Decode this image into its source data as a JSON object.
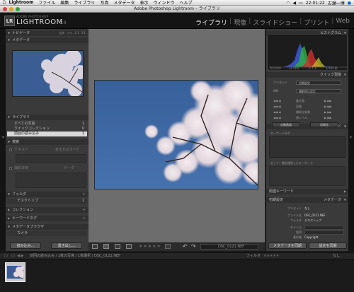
{
  "menubar": {
    "app": "Lightroom",
    "items": [
      "ファイル",
      "編集",
      "ライブラリ",
      "写真",
      "メタデータ",
      "表示",
      "ウィンドウ",
      "ヘルプ"
    ],
    "clock": "22:01:22",
    "user": "古瀬一博"
  },
  "window": {
    "title": "Adobe Photoshop Lightroom – ライブラリ"
  },
  "identity": {
    "badge": "LR",
    "adobe": "ADOBE PHOTOSHOP",
    "product": "LIGHTROOM",
    "version": "1.0"
  },
  "modules": [
    {
      "label": "ライブラリ",
      "active": true
    },
    {
      "label": "現像",
      "active": false
    },
    {
      "label": "スライドショー",
      "active": false
    },
    {
      "label": "プリント",
      "active": false
    },
    {
      "label": "Web",
      "active": false
    }
  ],
  "left": {
    "navigator": {
      "title": "ナビゲータ",
      "options": [
        "全体",
        "フル",
        "1:1",
        "3:1"
      ]
    },
    "metadata_browser_top": {
      "title": "メタデータ"
    },
    "library": {
      "title": "ライブラリ",
      "items": [
        {
          "label": "すべての写真",
          "count": "1"
        },
        {
          "label": "クイックコレクション",
          "count": "0"
        },
        {
          "label": "前回の読み込み",
          "count": "1",
          "selected": true
        }
      ]
    },
    "find": {
      "title": "検索",
      "text_label": "テキスト",
      "text_value": "含まれるすべて",
      "date_label": "撮影日時",
      "date_value": "データ"
    },
    "folders": {
      "title": "フォルダ",
      "item": "デスクトップ",
      "count": "1"
    },
    "collections": {
      "title": "コレクション"
    },
    "keyword_tags": {
      "title": "キーワードタグ"
    },
    "metadata_browser": {
      "title": "メタデータブラウザ",
      "item": "カメラ"
    },
    "buttons": {
      "import": "読み込み...",
      "export": "書き出し..."
    }
  },
  "center": {
    "filename": "DSC_0121.NEF"
  },
  "right": {
    "histogram": {
      "title": "ヒストグラム",
      "iso": "ISO 640",
      "focal": "31 mm",
      "aperture": "f/ 7.1",
      "shutter": "1/100 秒"
    },
    "quick_develop": {
      "title": "クイック現像",
      "preset_label": "プリセット",
      "preset_value": "初期設定",
      "wb_label": "WB",
      "wb_value": "撮影時の設定",
      "exposure": "露光量",
      "recovery": "回復",
      "fill": "補助光効果",
      "blacks": "黒レベル",
      "auto_tone": "自動階調",
      "reset": "初期化"
    },
    "keywords": {
      "title": "キーワード",
      "tags_label": "キーワードタグ",
      "recent_label": "セット：最近使用したキーワード"
    },
    "keyword_list": {
      "title": "関連キーワード"
    },
    "metadata": {
      "title": "メタデータ",
      "mode": "初期設定",
      "preset_label": "プリセット",
      "preset_value": "なし",
      "rows": [
        {
          "key": "ファイル名",
          "value": "DSC_0121.NEF"
        },
        {
          "key": "フォルダ",
          "value": "デスクトップ"
        },
        {
          "key": "タイトル",
          "value": ""
        },
        {
          "key": "説明",
          "value": ""
        },
        {
          "key": "著作権",
          "value": "Copyright"
        }
      ]
    },
    "buttons": {
      "sync_meta": "メタデータを同期",
      "sync_settings": "設定を同期"
    }
  },
  "filmstrip": {
    "page": "1 2",
    "info": "前回の読み込み / 1枚の写真 / 1枚選択 / DSC_0121.NEF",
    "filter_label": "フィルタ",
    "filter_value": "なし"
  },
  "colors": {
    "sky": "#3a5e94",
    "active_module": "#e8e8e8"
  }
}
